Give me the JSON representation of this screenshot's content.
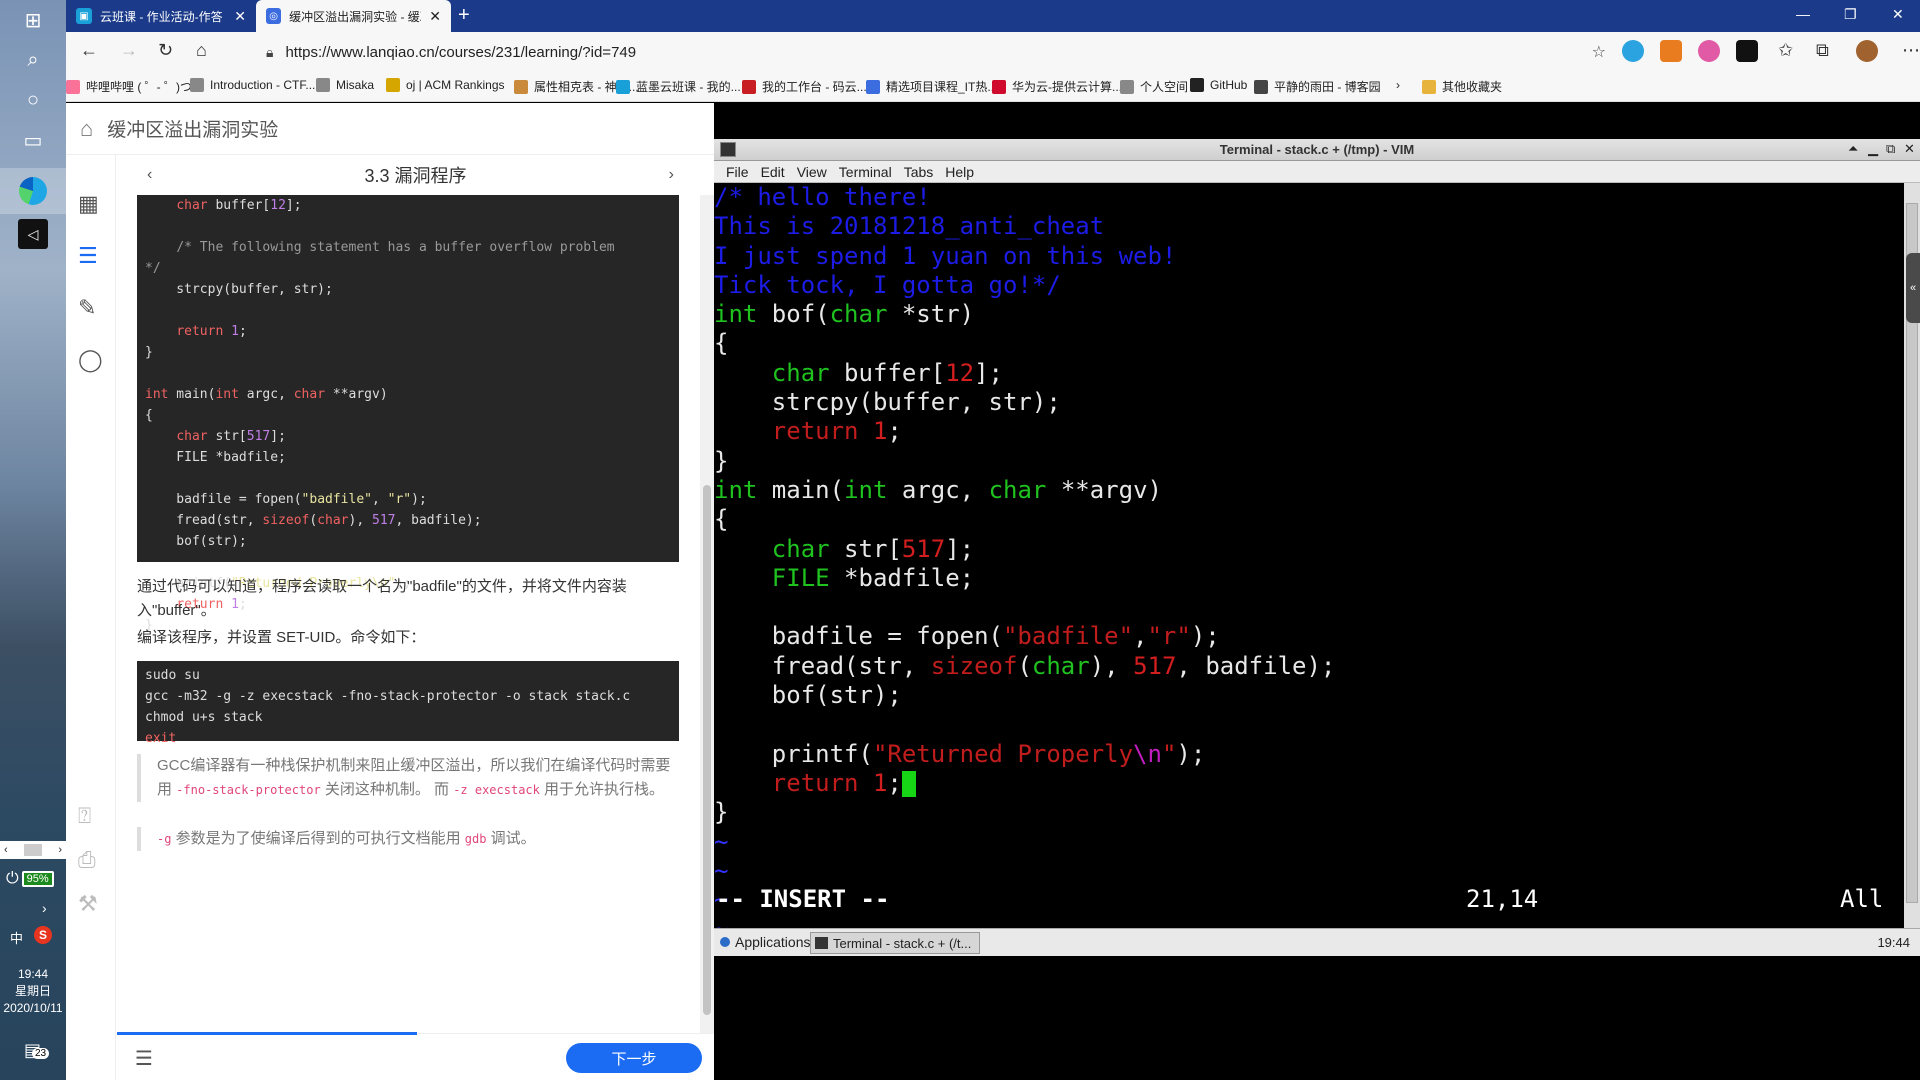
{
  "os": {
    "battery": "95%",
    "ime": "中",
    "sogou": "S",
    "clock": {
      "time": "19:44",
      "weekday": "星期日",
      "date": "2020/10/11"
    },
    "notif_count": "23"
  },
  "browser": {
    "tabs": [
      {
        "title": "云班课 - 作业活动-作答",
        "fav_color": "#1aa0d8"
      },
      {
        "title": "缓冲区溢出漏洞实验 - 缓冲区溢",
        "fav_color": "#3b6ce0"
      }
    ],
    "url": "https://www.lanqiao.cn/courses/231/learning/?id=749",
    "bookmarks": [
      {
        "label": "哔哩哔哩 ( ゜- ゜)つ...",
        "color": "#fb7299"
      },
      {
        "label": "Introduction - CTF...",
        "color": "#888888"
      },
      {
        "label": "Misaka",
        "color": "#888888"
      },
      {
        "label": "oj | ACM Rankings",
        "color": "#d6a600"
      },
      {
        "label": "属性相克表 - 神奇...",
        "color": "#c98a3c"
      },
      {
        "label": "蓝墨云班课 - 我的...",
        "color": "#1aa0d8"
      },
      {
        "label": "我的工作台 - 码云...",
        "color": "#c71d23"
      },
      {
        "label": "精选项目课程_IT热...",
        "color": "#3b6ce0"
      },
      {
        "label": "华为云-提供云计算...",
        "color": "#cf0a2c"
      },
      {
        "label": "个人空间",
        "color": "#888888"
      },
      {
        "label": "GitHub",
        "color": "#222222"
      },
      {
        "label": "平静的雨田 - 博客园",
        "color": "#444444"
      }
    ],
    "other_bookmarks": "其他收藏夹"
  },
  "page": {
    "course_title": "缓冲区溢出漏洞实验",
    "section_title": "3.3 漏洞程序",
    "code1": [
      [
        [
          "    ",
          ""
        ],
        [
          "char",
          "k"
        ],
        [
          " buffer[",
          ""
        ],
        [
          "12",
          "n"
        ],
        [
          "];",
          ""
        ]
      ],
      [
        [
          "",
          ""
        ]
      ],
      [
        [
          "    ",
          ""
        ],
        [
          "/* The following statement has a buffer overflow problem",
          "c"
        ]
      ],
      [
        [
          "*/",
          "c"
        ]
      ],
      [
        [
          "    strcpy(buffer, str);",
          ""
        ]
      ],
      [
        [
          "",
          ""
        ]
      ],
      [
        [
          "    ",
          ""
        ],
        [
          "return",
          "k"
        ],
        [
          " ",
          ""
        ],
        [
          "1",
          "n"
        ],
        [
          ";",
          ""
        ]
      ],
      [
        [
          "}",
          ""
        ]
      ],
      [
        [
          "",
          ""
        ]
      ],
      [
        [
          "int",
          "k"
        ],
        [
          " main(",
          ""
        ],
        [
          "int",
          "k"
        ],
        [
          " argc, ",
          ""
        ],
        [
          "char",
          "k"
        ],
        [
          " **argv)",
          ""
        ]
      ],
      [
        [
          "{",
          ""
        ]
      ],
      [
        [
          "    ",
          ""
        ],
        [
          "char",
          "k"
        ],
        [
          " str[",
          ""
        ],
        [
          "517",
          "n"
        ],
        [
          "];",
          ""
        ]
      ],
      [
        [
          "    FILE *badfile;",
          ""
        ]
      ],
      [
        [
          "",
          ""
        ]
      ],
      [
        [
          "    badfile = fopen(",
          ""
        ],
        [
          "\"badfile\"",
          "s"
        ],
        [
          ", ",
          ""
        ],
        [
          "\"r\"",
          "s"
        ],
        [
          ");",
          ""
        ]
      ],
      [
        [
          "    fread(str, ",
          ""
        ],
        [
          "sizeof",
          "k"
        ],
        [
          "(",
          ""
        ],
        [
          "char",
          "k"
        ],
        [
          "), ",
          ""
        ],
        [
          "517",
          "n"
        ],
        [
          ", badfile);",
          ""
        ]
      ],
      [
        [
          "    bof(str);",
          ""
        ]
      ],
      [
        [
          "",
          ""
        ]
      ],
      [
        [
          "    printf(",
          ""
        ],
        [
          "\"Returned Properly\\n\"",
          "s"
        ],
        [
          ");",
          ""
        ]
      ],
      [
        [
          "    ",
          ""
        ],
        [
          "return",
          "k"
        ],
        [
          " ",
          ""
        ],
        [
          "1",
          "n"
        ],
        [
          ";",
          ""
        ]
      ],
      [
        [
          "}",
          ""
        ]
      ]
    ],
    "para1": "通过代码可以知道，程序会读取一个名为\"badfile\"的文件，并将文件内容装入\"buffer\"。",
    "para2": "编译该程序，并设置 SET-UID。命令如下：",
    "code2": [
      [
        [
          "sudo su",
          ""
        ]
      ],
      [
        [
          "gcc -m32 -g -z execstack -fno-stack-protector -o stack stack.c",
          ""
        ]
      ],
      [
        [
          "chmod u+s stack",
          ""
        ]
      ],
      [
        [
          "exit",
          "k"
        ]
      ]
    ],
    "quote1": [
      [
        "GCC编译器有一种栈保护机制来阻止缓冲区溢出，所以我们在编译代码时需要用 ",
        ""
      ],
      [
        "-fno-stack-protector",
        "code"
      ],
      [
        " 关闭这种机制。 而 ",
        ""
      ],
      [
        "-z execstack",
        "code"
      ],
      [
        " 用于允许执行栈。",
        ""
      ]
    ],
    "quote2": [
      [
        "-g",
        "code"
      ],
      [
        " 参数是为了使编译后得到的可执行文档能用 ",
        ""
      ],
      [
        "gdb",
        "code"
      ],
      [
        " 调试。",
        ""
      ]
    ],
    "next_button": "下一步"
  },
  "vim": {
    "window_title": "Terminal - stack.c + (/tmp) - VIM",
    "menu": [
      "File",
      "Edit",
      "View",
      "Terminal",
      "Tabs",
      "Help"
    ],
    "lines": [
      [
        [
          "/* hello there!",
          "vc"
        ]
      ],
      [
        [
          "This is 20181218_anti_cheat",
          "vc"
        ]
      ],
      [
        [
          "I just spend 1 yuan on this web!",
          "vc"
        ]
      ],
      [
        [
          "Tick tock, I gotta go!*/",
          "vc"
        ]
      ],
      [
        [
          "int",
          "vk"
        ],
        [
          " bof(",
          ""
        ],
        [
          "char",
          "vk"
        ],
        [
          " *str)",
          ""
        ]
      ],
      [
        [
          "{",
          ""
        ]
      ],
      [
        [
          "    ",
          ""
        ],
        [
          "char",
          "vk"
        ],
        [
          " buffer[",
          ""
        ],
        [
          "12",
          "vn"
        ],
        [
          "];",
          ""
        ]
      ],
      [
        [
          "    strcpy(buffer, str);",
          ""
        ]
      ],
      [
        [
          "    ",
          ""
        ],
        [
          "return",
          "vs"
        ],
        [
          " ",
          ""
        ],
        [
          "1",
          "vn"
        ],
        [
          ";",
          ""
        ]
      ],
      [
        [
          "}",
          ""
        ]
      ],
      [
        [
          "int",
          "vk"
        ],
        [
          " main(",
          ""
        ],
        [
          "int",
          "vk"
        ],
        [
          " argc, ",
          ""
        ],
        [
          "char",
          "vk"
        ],
        [
          " **argv)",
          ""
        ]
      ],
      [
        [
          "{",
          ""
        ]
      ],
      [
        [
          "    ",
          ""
        ],
        [
          "char",
          "vk"
        ],
        [
          " str[",
          ""
        ],
        [
          "517",
          "vn"
        ],
        [
          "];",
          ""
        ]
      ],
      [
        [
          "    ",
          ""
        ],
        [
          "FILE",
          "vk"
        ],
        [
          " *badfile;",
          ""
        ]
      ],
      [
        [
          "",
          ""
        ]
      ],
      [
        [
          "    badfile = fopen(",
          ""
        ],
        [
          "\"badfile\"",
          "vs"
        ],
        [
          ",",
          ""
        ],
        [
          "\"r\"",
          "vs"
        ],
        [
          ");",
          ""
        ]
      ],
      [
        [
          "    fread(str, ",
          ""
        ],
        [
          "sizeof",
          "vs"
        ],
        [
          "(",
          ""
        ],
        [
          "char",
          "vk"
        ],
        [
          "), ",
          ""
        ],
        [
          "517",
          "vn"
        ],
        [
          ", badfile);",
          ""
        ]
      ],
      [
        [
          "    bof(str);",
          ""
        ]
      ],
      [
        [
          "",
          ""
        ]
      ],
      [
        [
          "    printf(",
          ""
        ],
        [
          "\"Returned Properly",
          "vs"
        ],
        [
          "\\n",
          "vsp"
        ],
        [
          "\"",
          "vs"
        ],
        [
          ");",
          ""
        ]
      ],
      [
        [
          "    ",
          ""
        ],
        [
          "return",
          "vs"
        ],
        [
          " ",
          ""
        ],
        [
          "1",
          "vn"
        ],
        [
          ";",
          ""
        ],
        [
          "CURSOR",
          "cursor"
        ]
      ],
      [
        [
          "}",
          ""
        ]
      ],
      [
        [
          "~",
          "vt"
        ]
      ],
      [
        [
          "~",
          "vt"
        ]
      ],
      [
        [
          "~",
          "vt"
        ]
      ],
      [
        [
          "~",
          "vt"
        ]
      ]
    ],
    "mode": "-- INSERT --",
    "position": "21,14",
    "scroll": "All",
    "taskbar": {
      "apps": "Applications",
      "task": "Terminal - stack.c + (/t...",
      "time": "19:44"
    }
  }
}
